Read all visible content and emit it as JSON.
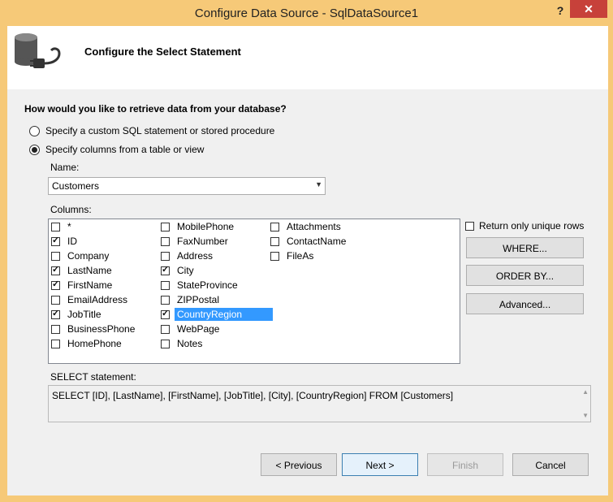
{
  "window": {
    "title": "Configure Data Source - SqlDataSource1",
    "help_label": "?",
    "close_label": "✕"
  },
  "header": {
    "title": "Configure the Select Statement",
    "icon": "database-plug-icon"
  },
  "question": "How would you like to retrieve data from your database?",
  "options": [
    {
      "label": "Specify a custom SQL statement or stored procedure",
      "checked": false
    },
    {
      "label": "Specify columns from a table or view",
      "checked": true
    }
  ],
  "name_label": "Name:",
  "name_value": "Customers",
  "columns_label": "Columns:",
  "columns": [
    {
      "name": "*",
      "checked": false
    },
    {
      "name": "ID",
      "checked": true
    },
    {
      "name": "Company",
      "checked": false
    },
    {
      "name": "LastName",
      "checked": true
    },
    {
      "name": "FirstName",
      "checked": true
    },
    {
      "name": "EmailAddress",
      "checked": false
    },
    {
      "name": "JobTitle",
      "checked": true
    },
    {
      "name": "BusinessPhone",
      "checked": false
    },
    {
      "name": "HomePhone",
      "checked": false
    },
    {
      "name": "MobilePhone",
      "checked": false
    },
    {
      "name": "FaxNumber",
      "checked": false
    },
    {
      "name": "Address",
      "checked": false
    },
    {
      "name": "City",
      "checked": true
    },
    {
      "name": "StateProvince",
      "checked": false
    },
    {
      "name": "ZIPPostal",
      "checked": false
    },
    {
      "name": "CountryRegion",
      "checked": true,
      "selected": true
    },
    {
      "name": "WebPage",
      "checked": false
    },
    {
      "name": "Notes",
      "checked": false
    },
    {
      "name": "Attachments",
      "checked": false
    },
    {
      "name": "ContactName",
      "checked": false
    },
    {
      "name": "FileAs",
      "checked": false
    }
  ],
  "unique_rows_label": "Return only unique rows",
  "unique_rows_checked": false,
  "buttons": {
    "where": "WHERE...",
    "order_by": "ORDER BY...",
    "advanced": "Advanced...",
    "previous": "< Previous",
    "next": "Next >",
    "finish": "Finish",
    "cancel": "Cancel"
  },
  "select_statement_label": "SELECT statement:",
  "select_statement": "SELECT [ID], [LastName], [FirstName], [JobTitle], [City], [CountryRegion] FROM [Customers]",
  "colors": {
    "title_bar": "#f6c978",
    "close_button": "#c7413a",
    "selection": "#3399ff"
  }
}
